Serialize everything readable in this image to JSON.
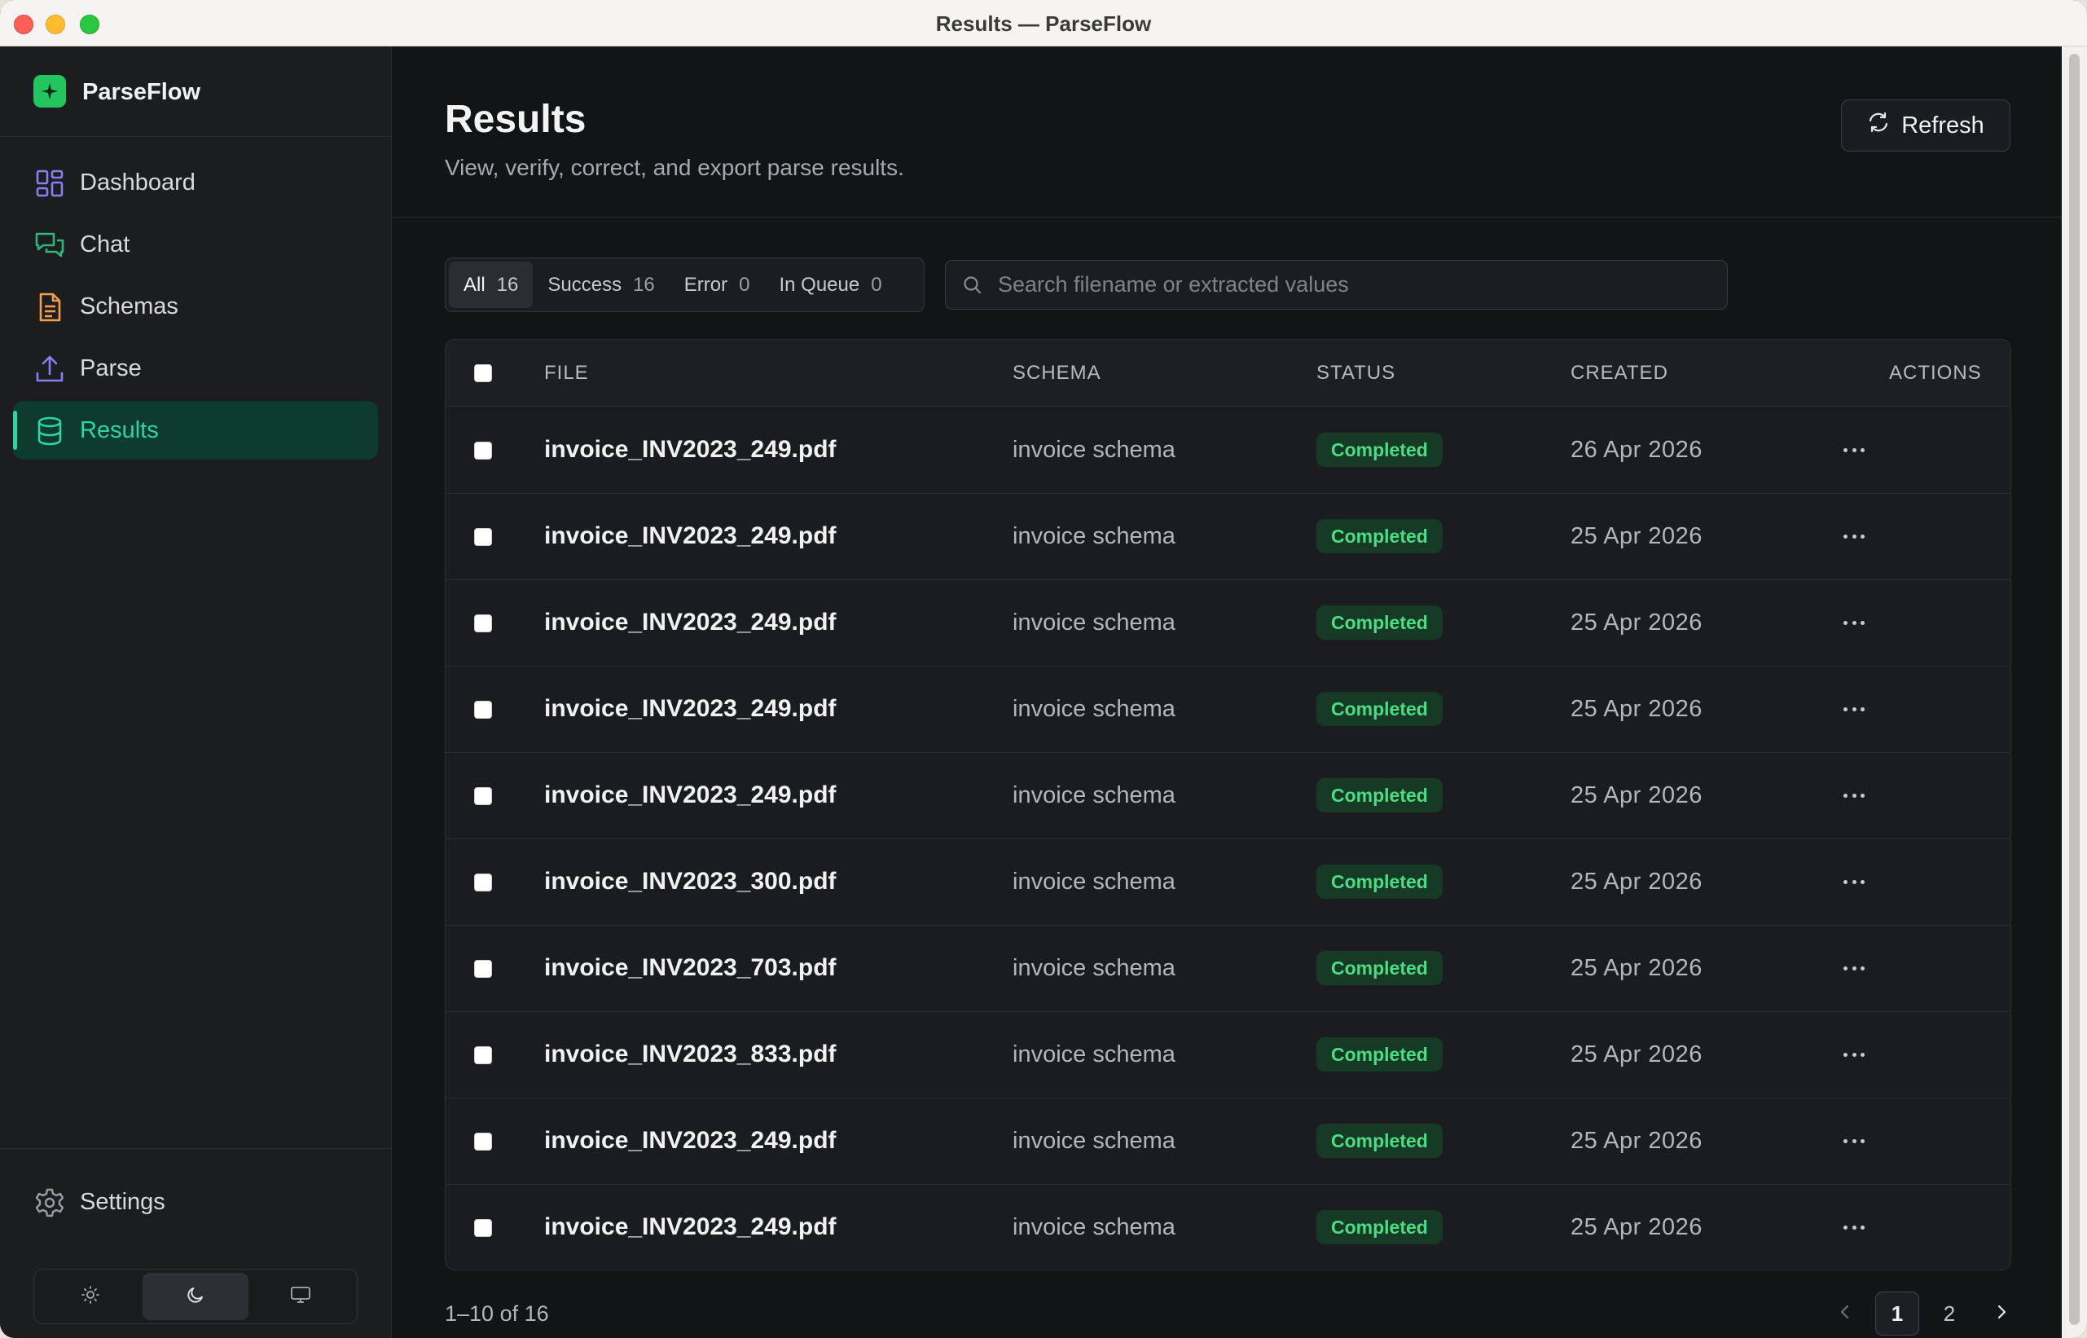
{
  "window": {
    "title": "Results — ParseFlow"
  },
  "brand": {
    "name": "ParseFlow",
    "accent": "#22c55e"
  },
  "sidebar": {
    "items": [
      {
        "label": "Dashboard",
        "icon": "dashboard-grid-icon",
        "color": "#8b7cf6"
      },
      {
        "label": "Chat",
        "icon": "chat-bubbles-icon",
        "color": "#2fb67a"
      },
      {
        "label": "Schemas",
        "icon": "document-icon",
        "color": "#f59e4b"
      },
      {
        "label": "Parse",
        "icon": "upload-icon",
        "color": "#8b7cf6"
      },
      {
        "label": "Results",
        "icon": "database-icon",
        "color": "#2dd4a4",
        "active": true
      }
    ],
    "settings_label": "Settings",
    "theme_options": [
      "sun-icon",
      "moon-icon",
      "monitor-icon"
    ],
    "theme_selected": "moon-icon"
  },
  "header": {
    "title": "Results",
    "subtitle": "View, verify, correct, and export parse results.",
    "refresh_label": "Refresh"
  },
  "filters": {
    "tabs": [
      {
        "label": "All",
        "count": "16",
        "active": true
      },
      {
        "label": "Success",
        "count": "16"
      },
      {
        "label": "Error",
        "count": "0"
      },
      {
        "label": "In Queue",
        "count": "0"
      }
    ],
    "search_placeholder": "Search filename or extracted values"
  },
  "table": {
    "columns": [
      "FILE",
      "SCHEMA",
      "STATUS",
      "CREATED",
      "ACTIONS"
    ],
    "rows": [
      {
        "file": "invoice_INV2023_249.pdf",
        "schema": "invoice schema",
        "status": "Completed",
        "created": "26 Apr 2026"
      },
      {
        "file": "invoice_INV2023_249.pdf",
        "schema": "invoice schema",
        "status": "Completed",
        "created": "25 Apr 2026"
      },
      {
        "file": "invoice_INV2023_249.pdf",
        "schema": "invoice schema",
        "status": "Completed",
        "created": "25 Apr 2026"
      },
      {
        "file": "invoice_INV2023_249.pdf",
        "schema": "invoice schema",
        "status": "Completed",
        "created": "25 Apr 2026"
      },
      {
        "file": "invoice_INV2023_249.pdf",
        "schema": "invoice schema",
        "status": "Completed",
        "created": "25 Apr 2026"
      },
      {
        "file": "invoice_INV2023_300.pdf",
        "schema": "invoice schema",
        "status": "Completed",
        "created": "25 Apr 2026"
      },
      {
        "file": "invoice_INV2023_703.pdf",
        "schema": "invoice schema",
        "status": "Completed",
        "created": "25 Apr 2026"
      },
      {
        "file": "invoice_INV2023_833.pdf",
        "schema": "invoice schema",
        "status": "Completed",
        "created": "25 Apr 2026"
      },
      {
        "file": "invoice_INV2023_249.pdf",
        "schema": "invoice schema",
        "status": "Completed",
        "created": "25 Apr 2026"
      },
      {
        "file": "invoice_INV2023_249.pdf",
        "schema": "invoice schema",
        "status": "Completed",
        "created": "25 Apr 2026"
      }
    ]
  },
  "pagination": {
    "summary": "1–10 of 16",
    "pages": [
      "1",
      "2"
    ],
    "current": "1"
  }
}
